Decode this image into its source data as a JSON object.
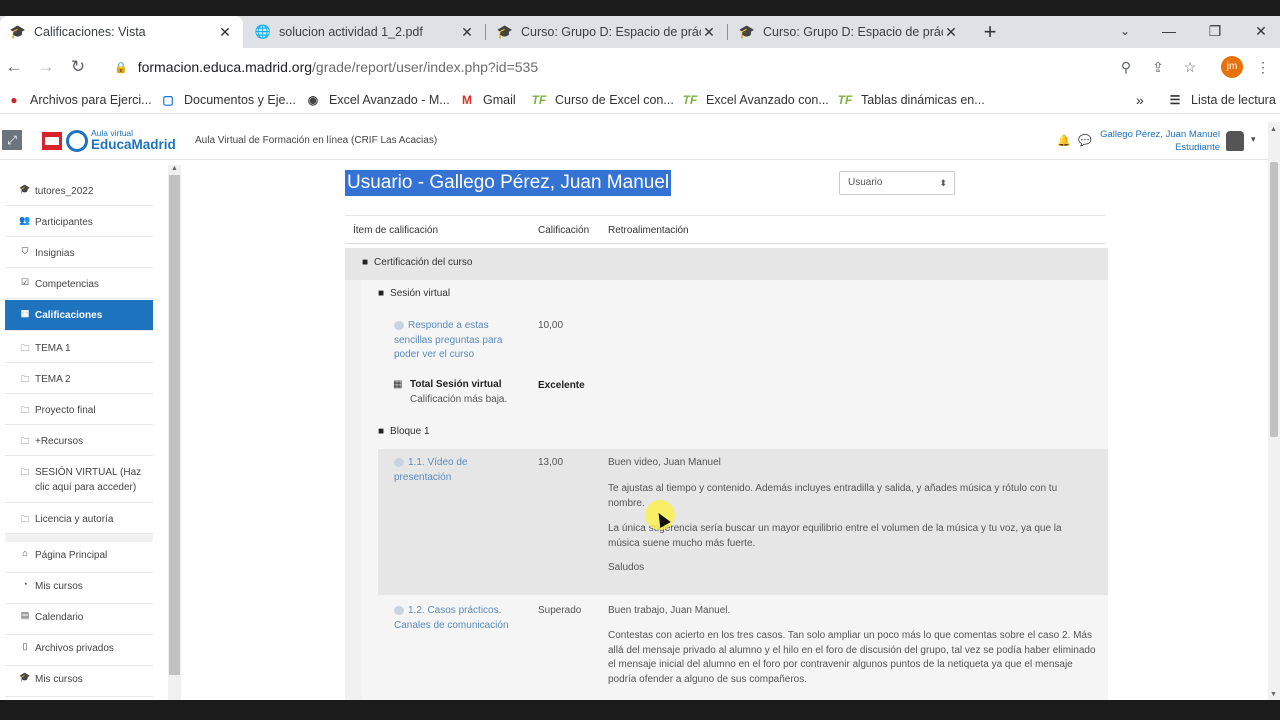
{
  "browser": {
    "tabs": [
      {
        "title": "Calificaciones: Vista",
        "icon": "moodle-hat-icon"
      },
      {
        "title": "solucion actividad 1_2.pdf",
        "icon": "globe-icon"
      },
      {
        "title": "Curso: Grupo D: Espacio de práct",
        "icon": "moodle-hat-icon"
      },
      {
        "title": "Curso: Grupo D: Espacio de práct",
        "icon": "moodle-hat-icon"
      }
    ],
    "new_tab": "+",
    "url_host": "formacion.educa.madrid.org",
    "url_path": "/grade/report/user/index.php?id=535",
    "profile_initials": "jm",
    "bookmarks": [
      {
        "label": "Archivos para Ejerci...",
        "icon": "red-dot-icon"
      },
      {
        "label": "Documentos y Eje...",
        "icon": "doc-icon"
      },
      {
        "label": "Excel Avanzado - M...",
        "icon": "globe-icon"
      },
      {
        "label": "Gmail",
        "icon": "gmail-icon"
      },
      {
        "label": "Curso de Excel con...",
        "icon": "tf-icon"
      },
      {
        "label": "Excel Avanzado con...",
        "icon": "tf-icon"
      },
      {
        "label": "Tablas dinámicas en...",
        "icon": "tf-icon"
      }
    ],
    "more_bookmarks": "»",
    "reading_list": "Lista de lectura"
  },
  "moodle": {
    "logo_small": "Aula virtual",
    "logo_big": "EducaMadrid",
    "site_name": "Aula Virtual de Formación en línea (CRIF Las Acacias)",
    "user_name": "Gallego Pérez, Juan Manuel",
    "user_role": "Estudiante"
  },
  "sidebar": {
    "items": [
      {
        "label": "tutores_2022",
        "icon": "graduation-cap-icon"
      },
      {
        "label": "Participantes",
        "icon": "users-icon"
      },
      {
        "label": "Insignias",
        "icon": "shield-icon"
      },
      {
        "label": "Competencias",
        "icon": "checkbox-icon"
      },
      {
        "label": "Calificaciones",
        "icon": "table-icon",
        "active": true
      },
      {
        "label": "TEMA 1",
        "icon": "folder-icon"
      },
      {
        "label": "TEMA 2",
        "icon": "folder-icon"
      },
      {
        "label": "Proyecto final",
        "icon": "folder-icon"
      },
      {
        "label": "+Recursos",
        "icon": "folder-icon"
      },
      {
        "label": "SESIÓN VIRTUAL (Haz clic aquí para acceder)",
        "icon": "folder-icon"
      },
      {
        "label": "Licencia y autoría",
        "icon": "folder-icon"
      },
      {
        "label": "Página Principal",
        "icon": "home-icon"
      },
      {
        "label": "Mis cursos",
        "icon": "dashboard-icon"
      },
      {
        "label": "Calendario",
        "icon": "calendar-icon"
      },
      {
        "label": "Archivos privados",
        "icon": "file-icon"
      },
      {
        "label": "Mis cursos",
        "icon": "graduation-cap-icon"
      }
    ]
  },
  "report": {
    "heading": "Usuario - Gallego Pérez, Juan Manuel",
    "view_select": "Usuario",
    "columns": {
      "item": "Ítem de calificación",
      "grade": "Calificación",
      "feedback": "Retroalimentación"
    },
    "course_category": "Certificación del curso",
    "categories": [
      {
        "name": "Sesión virtual",
        "items": [
          {
            "name": "Responde a estas sencillas preguntas para poder ver el curso",
            "grade": "10,00"
          }
        ],
        "total": {
          "name": "Total Sesión virtual",
          "sub": "Calificación más baja.",
          "grade": "Excelente"
        }
      },
      {
        "name": "Bloque 1",
        "items": [
          {
            "name": "1.1. Vídeo de presentación",
            "grade": "13,00",
            "feedback": [
              "Buen video, Juan Manuel",
              "Te ajustas al tiempo y contenido. Además incluyes entradilla y salida, y añades música y rótulo con tu nombre.",
              "La única sugerencia sería buscar un mayor equilibrio entre el volumen de la música y tu voz, ya que la música suene mucho más fuerte.",
              "Saludos"
            ]
          },
          {
            "name": "1.2. Casos prácticos. Canales de comunicación",
            "grade": "Superado",
            "feedback": [
              "Buen trabajo, Juan Manuel.",
              "Contestas con acierto en los tres casos. Tan solo ampliar un poco más lo que comentas sobre el caso 2. Más allá del mensaje privado al alumno y el hilo en el foro de discusión del grupo, tal vez se podía haber eliminado el mensaje inicial del alumno en el foro por contravenir algunos puntos de la netiqueta ya que el mensaje podría ofender a alguno de sus compañeros."
            ]
          }
        ]
      }
    ]
  }
}
